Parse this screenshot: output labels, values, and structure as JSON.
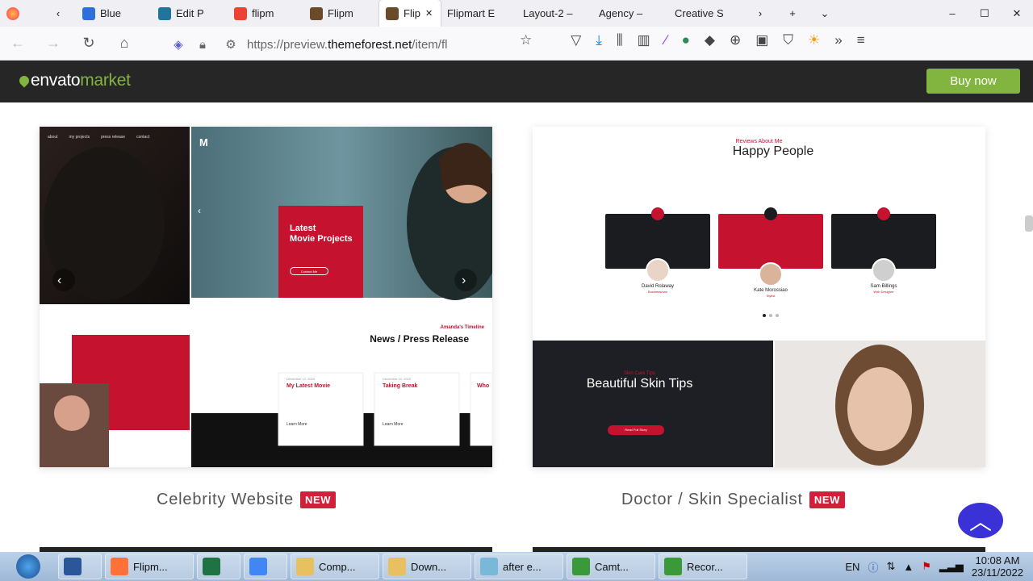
{
  "browser": {
    "tabs": [
      {
        "label": "Blue",
        "icon": "edge-icon",
        "color": "#2f6fd8"
      },
      {
        "label": "Edit P",
        "icon": "wordpress-icon",
        "color": "#21759b"
      },
      {
        "label": "flipm",
        "icon": "google-icon",
        "color": "#ea4335"
      },
      {
        "label": "Flipm",
        "icon": "flipmart-icon",
        "color": "#6b4a2a"
      },
      {
        "label": "Flip",
        "icon": "flipmart-icon",
        "color": "#6b4a2a"
      },
      {
        "label": "Flipmart E",
        "icon": "",
        "color": ""
      },
      {
        "label": "Layout-2 –",
        "icon": "",
        "color": ""
      },
      {
        "label": "Agency –",
        "icon": "",
        "color": ""
      },
      {
        "label": "Creative S",
        "icon": "",
        "color": ""
      }
    ],
    "active_tab_index": 4,
    "url_prefix": "https://preview.",
    "url_domain": "themeforest.net",
    "url_rest": "/item/fl"
  },
  "envato": {
    "logo_envato": "envato",
    "logo_market": "market",
    "buy_label": "Buy now",
    "accent": "#82b440"
  },
  "cards": {
    "celebrity": {
      "caption": "Celebrity Website",
      "badge": "NEW",
      "nav": [
        "about",
        "my projects",
        "press release",
        "contact"
      ],
      "hero_title_1": "Latest",
      "hero_title_2": "Movie Projects",
      "hero_button": "Contact Me",
      "timeline_kicker": "Amanda's Timeline",
      "timeline_title": "News / Press Release",
      "news": [
        {
          "date": "December 12, 2020",
          "title": "My Latest Movie",
          "link": "Learn More"
        },
        {
          "date": "December 12, 2020",
          "title": "Taking Break",
          "link": "Learn More"
        },
        {
          "date": "December 12, 2020",
          "title": "Who",
          "link": "Learn More"
        }
      ]
    },
    "doctor": {
      "caption": "Doctor / Skin Specialist",
      "badge": "NEW",
      "kicker": "Reviews About Me",
      "title": "Happy People",
      "reviewers": [
        {
          "name": "David Rolaway",
          "role": "Businessman"
        },
        {
          "name": "Kate Morossiao",
          "role": "Stylist"
        },
        {
          "name": "Sam Billings",
          "role": "Web Designer"
        }
      ],
      "skin_kicker": "Skin Care Tips",
      "skin_title": "Beautiful Skin Tips",
      "skin_button": "Read Full Story"
    }
  },
  "taskbar": {
    "items": [
      {
        "label": "Flipm...",
        "color": "#ff7139"
      },
      {
        "label": "",
        "color": "#1f7244"
      },
      {
        "label": "",
        "color": "#4285f4"
      },
      {
        "label": "Comp...",
        "color": "#e8c060"
      },
      {
        "label": "Down...",
        "color": "#e8c060"
      },
      {
        "label": "after e...",
        "color": "#7ab8d8"
      },
      {
        "label": "Camt...",
        "color": "#3a9a3a"
      },
      {
        "label": "Recor...",
        "color": "#3a9a3a"
      }
    ],
    "lang": "EN",
    "time": "10:08 AM",
    "date": "23/11/2022"
  }
}
